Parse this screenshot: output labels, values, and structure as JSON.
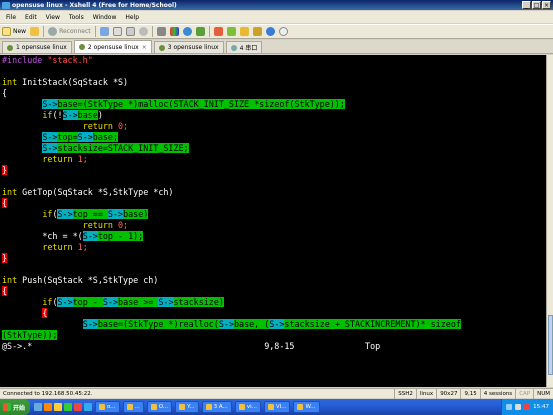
{
  "window": {
    "title": "opensuse linux - Xshell 4 (Free for Home/School)"
  },
  "menu": [
    "File",
    "Edit",
    "View",
    "Tools",
    "Window",
    "Help"
  ],
  "toolbar": {
    "new_label": "New",
    "reconnect_label": "Reconnect"
  },
  "tabs": [
    {
      "label": "1 opensuse linux",
      "active": false
    },
    {
      "label": "2 opensuse linux",
      "active": true
    },
    {
      "label": "3 opensuse linux",
      "active": false
    },
    {
      "label": "4 串口",
      "active": false
    }
  ],
  "terminal": {
    "lines": [
      [
        {
          "t": "#include ",
          "c": "c-pre"
        },
        {
          "t": "\"stack.h\"",
          "c": "c-str"
        }
      ],
      [],
      [
        {
          "t": "int",
          "c": "c-type"
        },
        {
          "t": " InitStack(SqStack *S)",
          "c": "c-norm"
        }
      ],
      [
        {
          "t": "{",
          "c": "c-norm"
        }
      ],
      [
        {
          "t": "        ",
          "c": "c-norm"
        },
        {
          "t": "S->",
          "c": "c-hl"
        },
        {
          "t": "base=(StkType *)malloc(STACK_INIT_SIZE *sizeof(StkType));",
          "c": "c-hlg"
        }
      ],
      [
        {
          "t": "        ",
          "c": "c-norm"
        },
        {
          "t": "if",
          "c": "c-kw"
        },
        {
          "t": "(!",
          "c": "c-norm"
        },
        {
          "t": "S->",
          "c": "c-hl"
        },
        {
          "t": "base",
          "c": "c-hlg"
        },
        {
          "t": ")",
          "c": "c-norm"
        }
      ],
      [
        {
          "t": "                ",
          "c": "c-norm"
        },
        {
          "t": "return",
          "c": "c-kw"
        },
        {
          "t": " 0;",
          "c": "c-num"
        }
      ],
      [
        {
          "t": "        ",
          "c": "c-norm"
        },
        {
          "t": "S->",
          "c": "c-hl"
        },
        {
          "t": "top=",
          "c": "c-hlg"
        },
        {
          "t": "S->",
          "c": "c-hl"
        },
        {
          "t": "base;",
          "c": "c-hlg"
        }
      ],
      [
        {
          "t": "        ",
          "c": "c-norm"
        },
        {
          "t": "S->",
          "c": "c-hl"
        },
        {
          "t": "stacksize=STACK_INIT_SIZE;",
          "c": "c-hlg"
        }
      ],
      [
        {
          "t": "        ",
          "c": "c-norm"
        },
        {
          "t": "return",
          "c": "c-kw"
        },
        {
          "t": " 1;",
          "c": "c-num"
        }
      ],
      [
        {
          "t": "}",
          "c": "c-red"
        }
      ],
      [],
      [
        {
          "t": "int",
          "c": "c-type"
        },
        {
          "t": " GetTop(SqStack *S,StkType *ch)",
          "c": "c-norm"
        }
      ],
      [
        {
          "t": "{",
          "c": "c-red"
        }
      ],
      [
        {
          "t": "        ",
          "c": "c-norm"
        },
        {
          "t": "if",
          "c": "c-kw"
        },
        {
          "t": "(",
          "c": "c-norm"
        },
        {
          "t": "S->",
          "c": "c-hl"
        },
        {
          "t": "top == ",
          "c": "c-hlg"
        },
        {
          "t": "S->",
          "c": "c-hl"
        },
        {
          "t": "base)",
          "c": "c-hlg"
        }
      ],
      [
        {
          "t": "                ",
          "c": "c-norm"
        },
        {
          "t": "return",
          "c": "c-kw"
        },
        {
          "t": " 0;",
          "c": "c-num"
        }
      ],
      [
        {
          "t": "        *ch = *(",
          "c": "c-norm"
        },
        {
          "t": "S->",
          "c": "c-hl"
        },
        {
          "t": "top - 1);",
          "c": "c-hlg"
        }
      ],
      [
        {
          "t": "        ",
          "c": "c-norm"
        },
        {
          "t": "return",
          "c": "c-kw"
        },
        {
          "t": " 1;",
          "c": "c-num"
        }
      ],
      [
        {
          "t": "}",
          "c": "c-red"
        }
      ],
      [],
      [
        {
          "t": "int",
          "c": "c-type"
        },
        {
          "t": " Push(SqStack *S,StkType ch)",
          "c": "c-norm"
        }
      ],
      [
        {
          "t": "{",
          "c": "c-red"
        }
      ],
      [
        {
          "t": "        ",
          "c": "c-norm"
        },
        {
          "t": "if",
          "c": "c-kw"
        },
        {
          "t": "(",
          "c": "c-norm"
        },
        {
          "t": "S->",
          "c": "c-hl"
        },
        {
          "t": "top - ",
          "c": "c-hlg"
        },
        {
          "t": "S->",
          "c": "c-hl"
        },
        {
          "t": "base >= ",
          "c": "c-hlg"
        },
        {
          "t": "S->",
          "c": "c-hl"
        },
        {
          "t": "stacksize)",
          "c": "c-hlg"
        }
      ],
      [
        {
          "t": "        ",
          "c": "c-norm"
        },
        {
          "t": "{",
          "c": "c-red"
        }
      ],
      [
        {
          "t": "                ",
          "c": "c-norm"
        },
        {
          "t": "S->",
          "c": "c-hl"
        },
        {
          "t": "base=(StkType *)realloc(",
          "c": "c-hlg"
        },
        {
          "t": "S->",
          "c": "c-hl"
        },
        {
          "t": "base, (",
          "c": "c-hlg"
        },
        {
          "t": "S->",
          "c": "c-hl"
        },
        {
          "t": "stacksize + STACKINCREMENT)* sizeof",
          "c": "c-hlg"
        }
      ],
      [
        {
          "t": "(StkType));",
          "c": "c-hlg"
        }
      ],
      [
        {
          "t": "@S->.*",
          "c": "c-norm"
        },
        {
          "t": "                                              9,8-15              Top",
          "c": "c-norm"
        }
      ]
    ]
  },
  "status": {
    "connection": "Connected to 192.168.50.45:22.",
    "protocol": "SSH2",
    "terminal": "linux",
    "size": "90x27",
    "cursor": "9,15",
    "sessions": "4 sessions",
    "caps": "CAP",
    "num": "NUM"
  },
  "taskbar": {
    "start_label": "开始",
    "tasks": [
      "o...",
      "...",
      "O...",
      "Y...",
      "3 A...",
      "vi...",
      "VI...",
      "W..."
    ],
    "clock": "15:47"
  },
  "colors": {
    "accent": "#0a246a",
    "terminal_bg": "#000000",
    "highlight": "#00c000"
  }
}
